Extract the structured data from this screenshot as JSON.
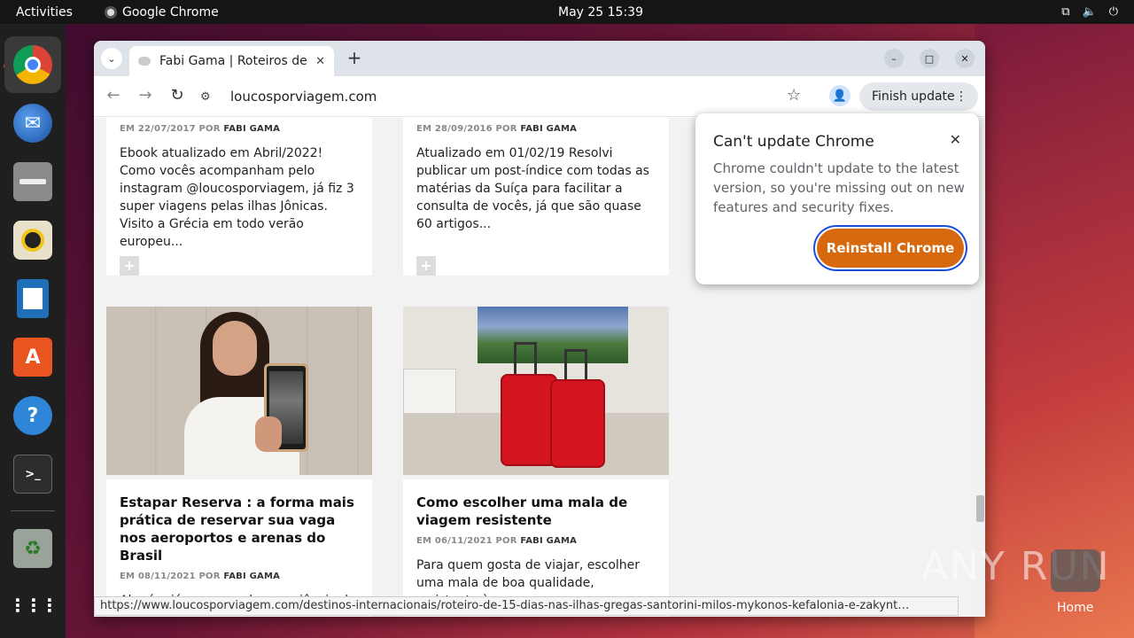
{
  "topbar": {
    "activities": "Activities",
    "app_name": "Google Chrome",
    "clock": "May 25  15:39"
  },
  "browser": {
    "tab_title": "Fabi Gama | Roteiros de V",
    "url": "loucosporviagem.com",
    "finish_update": "Finish update",
    "status_url": "https://www.loucosporviagem.com/destinos-internacionais/roteiro-de-15-dias-nas-ilhas-gregas-santorini-milos-mykonos-kefalonia-e-zakynt…"
  },
  "posts": [
    {
      "date": "EM 22/07/2017",
      "by": "POR",
      "author": "FABI GAMA",
      "excerpt": "Ebook atualizado em Abril/2022! Como vocês acompanham pelo instagram @loucosporviagem, já fiz 3 super viagens pelas ilhas Jônicas. Visito a Grécia em todo verão europeu..."
    },
    {
      "date": "EM 28/09/2016",
      "by": "POR",
      "author": "FABI GAMA",
      "excerpt": "Atualizado em 01/02/19 Resolvi publicar um post-índice com todas as matérias da Suíça para facilitar a consulta de vocês, já que são quase 60 artigos..."
    },
    {
      "title": "Estapar Reserva : a forma mais prática de reservar sua vaga nos aeroportos e arenas do Brasil",
      "date": "EM 08/11/2021",
      "by": "POR",
      "author": "FABI GAMA",
      "excerpt": "Alguém já passou pela experiência de"
    },
    {
      "title": "Como escolher uma mala de viagem resistente",
      "date": "EM 06/11/2021",
      "by": "POR",
      "author": "FABI GAMA",
      "excerpt": "Para quem gosta de viajar, escolher uma mala de boa qualidade, resistente à"
    }
  ],
  "popup": {
    "title": "Can't update Chrome",
    "body": "Chrome couldn't update to the latest version, so you're missing out on new features and security fixes.",
    "button": "Reinstall Chrome"
  },
  "desktop": {
    "home_label": "Home",
    "watermark": "ANY RUN"
  },
  "colors": {
    "accent_orange": "#d6690d",
    "focus_ring": "#1d4ed8",
    "ubuntu_orange": "#e95420"
  }
}
